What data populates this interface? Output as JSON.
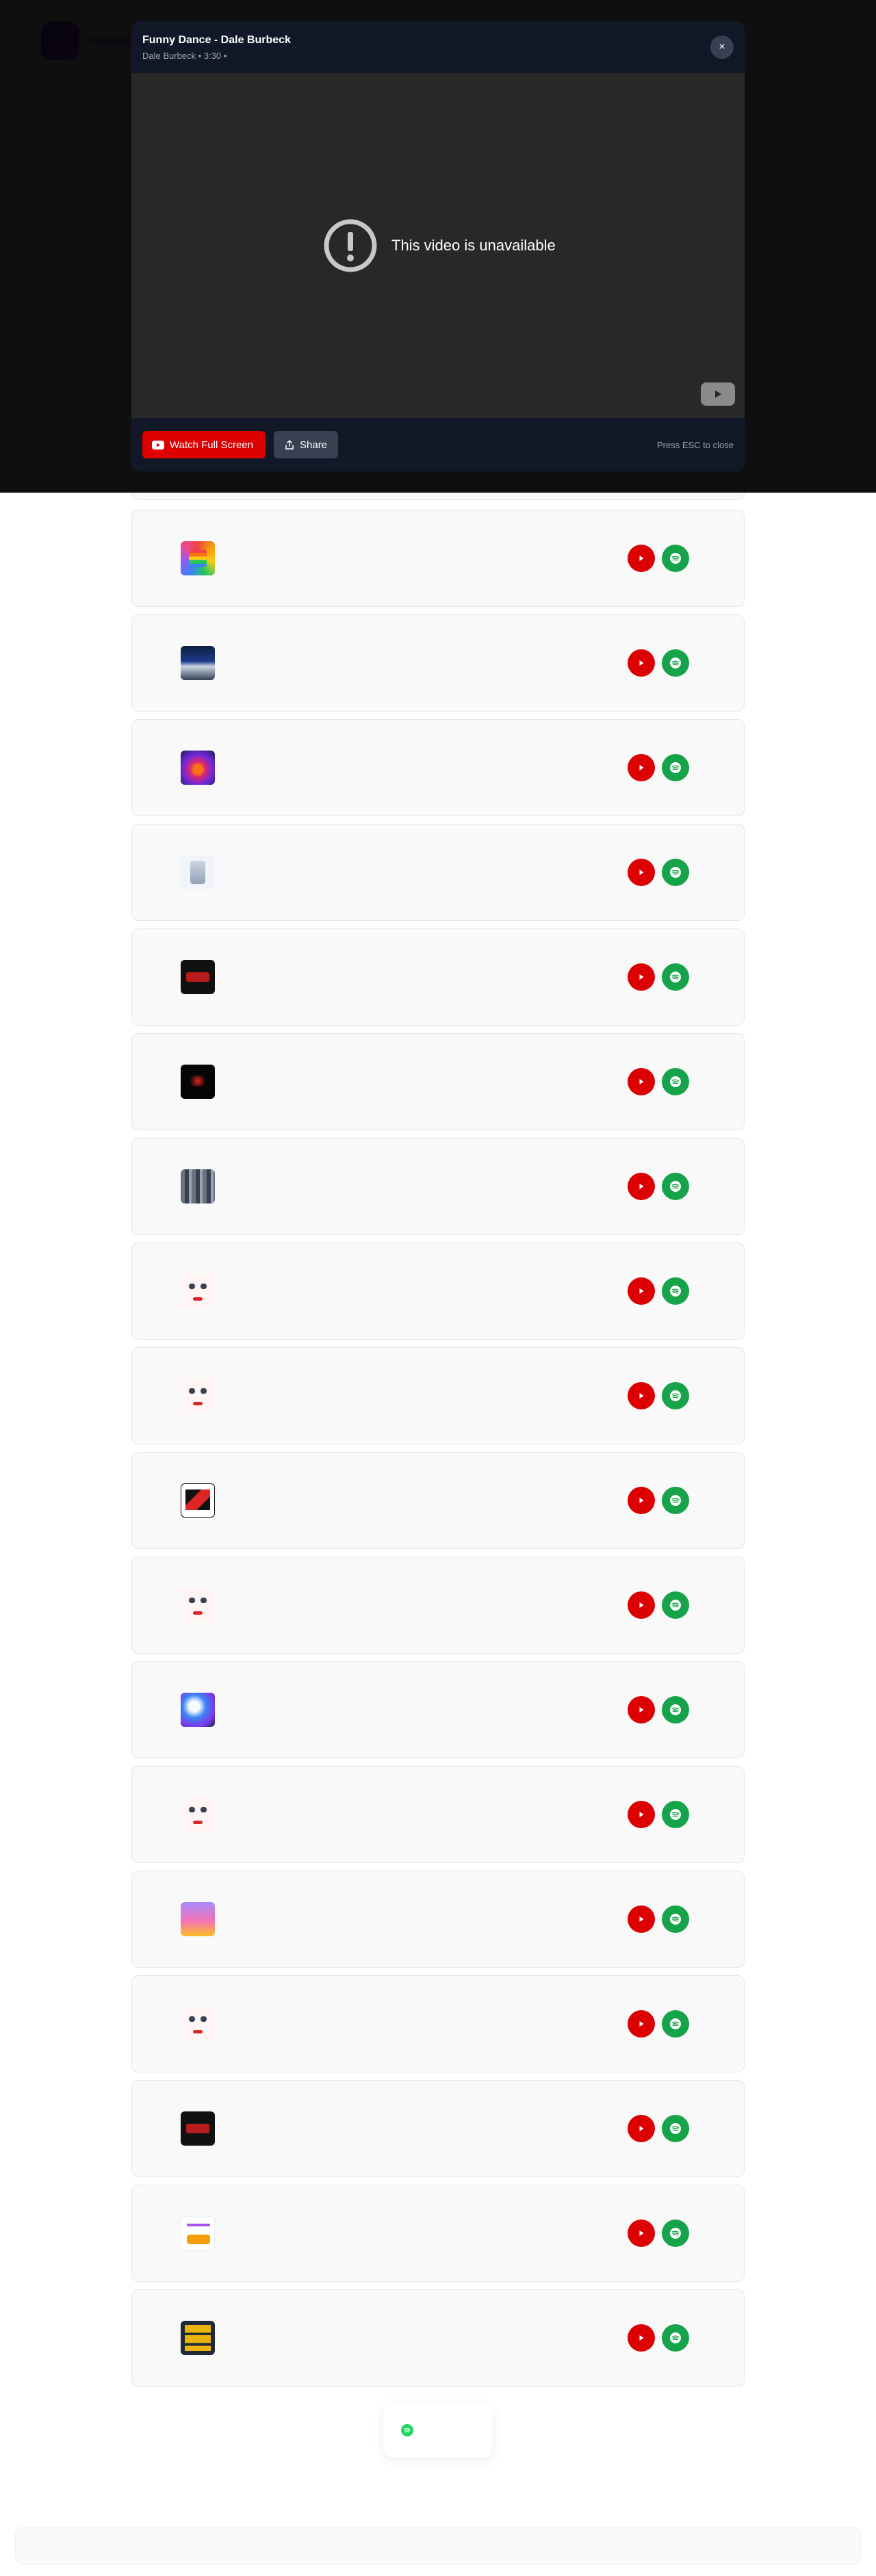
{
  "modal": {
    "title": "Funny Dance - Dale Burbeck",
    "subtitle": "Dale Burbeck • 3:30 •",
    "close_label": "×",
    "player_message": "This video is unavailable",
    "watch_label": "Watch Full Screen",
    "share_label": "Share",
    "esc_hint": "Press ESC to close"
  },
  "tracks": [
    {
      "cover": "rainbow-cover",
      "title": "",
      "artist": ""
    },
    {
      "cover": "mountain-night-cover",
      "title": "",
      "artist": ""
    },
    {
      "cover": "sunset-synthwave-cover",
      "title": "",
      "artist": ""
    },
    {
      "cover": "white-figure-cover",
      "title": "",
      "artist": ""
    },
    {
      "cover": "dark-red-cover",
      "title": "",
      "artist": ""
    },
    {
      "cover": "black-red-cover",
      "title": "",
      "artist": ""
    },
    {
      "cover": "city-collage-cover",
      "title": "",
      "artist": ""
    },
    {
      "cover": "face-cover",
      "title": "",
      "artist": ""
    },
    {
      "cover": "face-cover",
      "title": "",
      "artist": ""
    },
    {
      "cover": "red-black-graphic-cover",
      "title": "",
      "artist": ""
    },
    {
      "cover": "face-cover",
      "title": "",
      "artist": ""
    },
    {
      "cover": "blue-purple-cover",
      "title": "",
      "artist": ""
    },
    {
      "cover": "face-cover",
      "title": "",
      "artist": ""
    },
    {
      "cover": "pink-sunset-cover",
      "title": "",
      "artist": ""
    },
    {
      "cover": "face-cover",
      "title": "",
      "artist": ""
    },
    {
      "cover": "dark-red-cover",
      "title": "",
      "artist": ""
    },
    {
      "cover": "white-orange-cover",
      "title": "",
      "artist": ""
    },
    {
      "cover": "yellow-stripes-cover",
      "title": "",
      "artist": ""
    }
  ],
  "colors": {
    "youtube_red": "#dc0000",
    "spotify_green": "#16a34a",
    "modal_bg": "#111827",
    "player_bg": "#282828"
  },
  "icons": {
    "track_play": "youtube-play-icon",
    "track_spotify": "spotify-icon",
    "warning": "exclamation-circle-icon",
    "share": "share-icon"
  }
}
